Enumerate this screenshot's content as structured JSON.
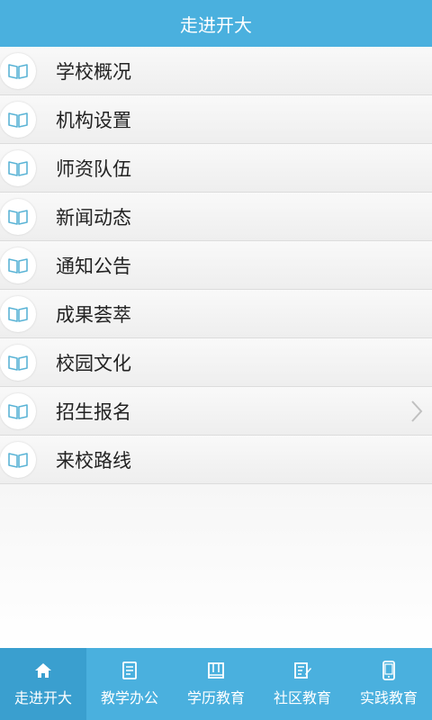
{
  "titlebar": {
    "title": "走进开大"
  },
  "list": {
    "items": [
      {
        "label": "学校概况"
      },
      {
        "label": "机构设置"
      },
      {
        "label": "师资队伍"
      },
      {
        "label": "新闻动态"
      },
      {
        "label": "通知公告"
      },
      {
        "label": "成果荟萃"
      },
      {
        "label": "校园文化"
      },
      {
        "label": "招生报名"
      },
      {
        "label": "来校路线"
      }
    ],
    "icon": "book-icon",
    "chevron_on_item": 7
  },
  "tabbar": {
    "tabs": [
      {
        "label": "走进开大",
        "icon": "home-icon",
        "active": true
      },
      {
        "label": "教学办公",
        "icon": "document-icon",
        "active": false
      },
      {
        "label": "学历教育",
        "icon": "open-book-icon",
        "active": false
      },
      {
        "label": "社区教育",
        "icon": "edit-icon",
        "active": false
      },
      {
        "label": "实践教育",
        "icon": "phone-icon",
        "active": false
      }
    ]
  },
  "colors": {
    "accent": "#4ab0de",
    "accent_active": "#3a9fcf",
    "icon_stroke": "#5bb4d6",
    "text": "#222222"
  }
}
